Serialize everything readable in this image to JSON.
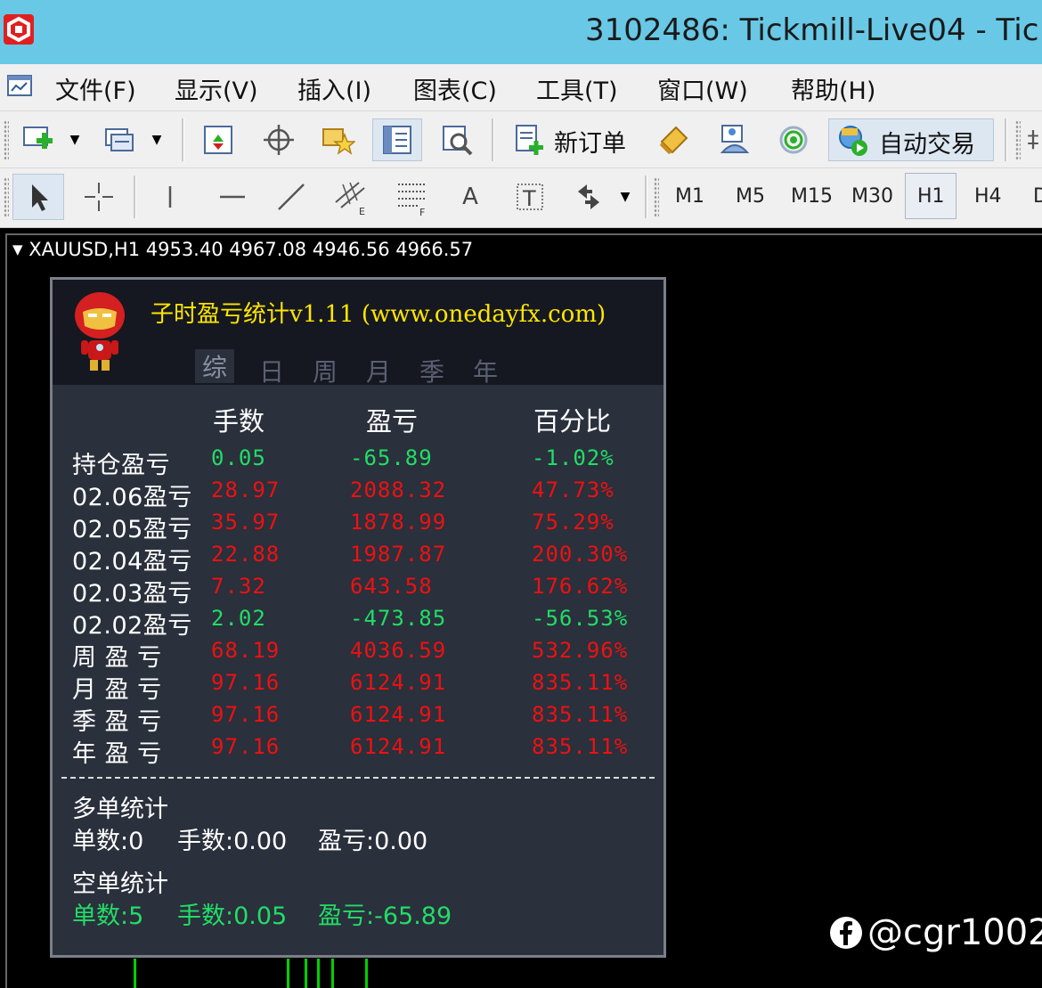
{
  "window": {
    "title": "3102486: Tickmill-Live04 - Tic"
  },
  "menu": {
    "items": [
      "文件(F)",
      "显示(V)",
      "插入(I)",
      "图表(C)",
      "工具(T)",
      "窗口(W)",
      "帮助(H)"
    ]
  },
  "toolbar": {
    "new_order_label": "新订单",
    "auto_trade_label": "自动交易",
    "icons": [
      "new-chart-icon",
      "profiles-icon",
      "market-watch-icon",
      "crosshair-icon",
      "favorites-icon",
      "navigator-icon",
      "strategy-tester-icon",
      "new-order-icon",
      "metaeditor-icon",
      "community-icon",
      "signals-icon",
      "auto-trading-icon"
    ]
  },
  "periods": {
    "items": [
      "M1",
      "M5",
      "M15",
      "M30",
      "H1",
      "H4"
    ],
    "selected": "H1"
  },
  "chart": {
    "header": "XAUUSD,H1  4953.40 4967.08 4946.56 4966.57"
  },
  "panel": {
    "title": "子时盈亏统计v1.11 (www.onedayfx.com)",
    "tabs": [
      "综",
      "日",
      "周",
      "月",
      "季",
      "年"
    ],
    "active_tab": "综",
    "columns": [
      "手数",
      "盈亏",
      "百分比"
    ],
    "rows": [
      {
        "label": "持仓盈亏",
        "lots": "0.05",
        "pl": "-65.89",
        "pct": "-1.02%",
        "color": "#22dd66"
      },
      {
        "label": "02.06盈亏",
        "lots": "28.97",
        "pl": "2088.32",
        "pct": "47.73%",
        "color": "#ee1111"
      },
      {
        "label": "02.05盈亏",
        "lots": "35.97",
        "pl": "1878.99",
        "pct": "75.29%",
        "color": "#ee1111"
      },
      {
        "label": "02.04盈亏",
        "lots": "22.88",
        "pl": "1987.87",
        "pct": "200.30%",
        "color": "#ee1111"
      },
      {
        "label": "02.03盈亏",
        "lots": "7.32",
        "pl": "643.58",
        "pct": "176.62%",
        "color": "#ee1111"
      },
      {
        "label": "02.02盈亏",
        "lots": "2.02",
        "pl": "-473.85",
        "pct": "-56.53%",
        "color": "#22dd66"
      },
      {
        "label": "周 盈 亏",
        "lots": "68.19",
        "pl": "4036.59",
        "pct": "532.96%",
        "color": "#ee1111"
      },
      {
        "label": "月 盈 亏",
        "lots": "97.16",
        "pl": "6124.91",
        "pct": "835.11%",
        "color": "#ee1111"
      },
      {
        "label": "季 盈 亏",
        "lots": "97.16",
        "pl": "6124.91",
        "pct": "835.11%",
        "color": "#ee1111"
      },
      {
        "label": "年 盈 亏",
        "lots": "97.16",
        "pl": "6124.91",
        "pct": "835.11%",
        "color": "#ee1111"
      }
    ],
    "long_stats": {
      "heading": "多单统计",
      "orders": "单数:0",
      "lots": "手数:0.00",
      "pl": "盈亏:0.00"
    },
    "short_stats": {
      "heading": "空单统计",
      "orders": "单数:5",
      "lots": "手数:0.05",
      "pl": "盈亏:-65.89"
    }
  },
  "watermark": {
    "text": "@cgr1002"
  },
  "colors": {
    "titlebar": "#68c8e6",
    "profit": "#ee1111",
    "loss": "#22dd66",
    "panel_title": "#ffe600"
  }
}
